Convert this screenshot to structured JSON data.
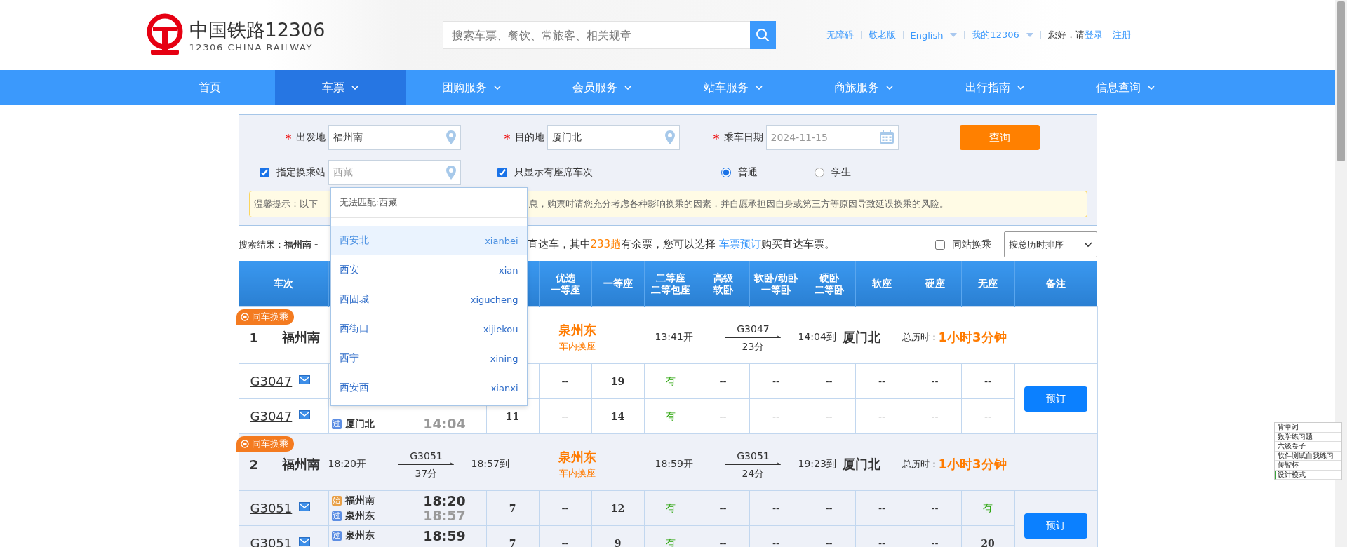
{
  "header": {
    "logo_title": "中国铁路12306",
    "logo_subtitle": "12306 CHINA RAILWAY",
    "search": {
      "placeholder": "搜索车票、餐饮、常旅客、相关规章"
    },
    "links": [
      {
        "label": "无障碍",
        "dropdown": false
      },
      {
        "label": "敬老版",
        "dropdown": false
      },
      {
        "label": "English",
        "dropdown": true
      },
      {
        "label": "我的12306",
        "dropdown": true
      }
    ],
    "greeting": "您好，请",
    "login": "登录",
    "register": "注册"
  },
  "nav": [
    {
      "label": "首页",
      "selected": false,
      "dropdown": false
    },
    {
      "label": "车票",
      "selected": true,
      "dropdown": true
    },
    {
      "label": "团购服务",
      "selected": false,
      "dropdown": true
    },
    {
      "label": "会员服务",
      "selected": false,
      "dropdown": true
    },
    {
      "label": "站车服务",
      "selected": false,
      "dropdown": true
    },
    {
      "label": "商旅服务",
      "selected": false,
      "dropdown": true
    },
    {
      "label": "出行指南",
      "selected": false,
      "dropdown": true
    },
    {
      "label": "信息查询",
      "selected": false,
      "dropdown": true
    }
  ],
  "form": {
    "fields": [
      {
        "required_mark": "*",
        "label": "出发地",
        "value": "福州南",
        "kind": "place"
      },
      {
        "required_mark": "*",
        "label": "目的地",
        "value": "厦门北",
        "kind": "place"
      },
      {
        "required_mark": "*",
        "label": "乘车日期",
        "value": "2024-11-15",
        "kind": "date"
      }
    ],
    "query_button": "查询",
    "transfer": {
      "label": "指定换乘站",
      "checked": true,
      "value": "西藏"
    },
    "seat_only": {
      "label": "只显示有座席车次",
      "checked": true
    },
    "ticket_types": [
      {
        "label": "普通",
        "selected": true
      },
      {
        "label": "学生",
        "selected": false
      }
    ],
    "tip_left": "温馨提示：以下",
    "tip_right": "息，购票时请您充分考虑各种影响换乘的因素，并自愿承担因自身或第三方等原因导致延误换乘的风险。"
  },
  "results": {
    "left": "搜索结果：**福州南 -**",
    "summary": [
      {
        "kind": "text",
        "text": "直达车，其中"
      },
      {
        "kind": "count",
        "text": "233趟"
      },
      {
        "kind": "text",
        "text": "有余票，您可以选择 "
      },
      {
        "kind": "link",
        "text": "车票预订"
      },
      {
        "kind": "text",
        "text": "购买直达车票。"
      }
    ],
    "same_station": {
      "label": "同站换乘",
      "checked": false
    },
    "sort": "按总历时排序"
  },
  "table": {
    "columns": [
      {
        "lines": [
          "车次"
        ]
      },
      {
        "lines": [
          "优选",
          "一等座"
        ]
      },
      {
        "lines": [
          "一等座"
        ]
      },
      {
        "lines": [
          "二等座",
          "二等包座"
        ]
      },
      {
        "lines": [
          "高级",
          "软卧"
        ]
      },
      {
        "lines": [
          "软卧/动卧",
          "一等卧"
        ]
      },
      {
        "lines": [
          "硬卧",
          "二等卧"
        ]
      },
      {
        "lines": [
          "软座"
        ]
      },
      {
        "lines": [
          "硬座"
        ]
      },
      {
        "lines": [
          "无座"
        ]
      },
      {
        "lines": [
          "备注"
        ]
      }
    ],
    "groups": [
      {
        "badge": "同车换乘",
        "index": "1",
        "from": "福州南",
        "highlighted": false,
        "leg2": {
          "dep": "13:41开",
          "train": "G3047",
          "duration": "23分",
          "arr": "14:04到"
        },
        "transfer": {
          "station": "泉州东",
          "note": "车内换座"
        },
        "to": "厦门北",
        "total_label": "总历时：",
        "total": "1小时3分钟",
        "book": "预订",
        "trains": [
          {
            "number": "G3047",
            "seats": [
              {
                "kind": "none",
                "text": "--"
              },
              {
                "kind": "count",
                "text": "19"
              },
              {
                "kind": "available",
                "text": "有"
              },
              {
                "kind": "none",
                "text": "--"
              },
              {
                "kind": "none",
                "text": "--"
              },
              {
                "kind": "none",
                "text": "--"
              },
              {
                "kind": "none",
                "text": "--"
              },
              {
                "kind": "none",
                "text": "--"
              },
              {
                "kind": "none",
                "text": "--"
              }
            ]
          },
          {
            "number": "G3047",
            "stops": [
              {
                "kind": "pass",
                "mark": "过",
                "name": "厦门北"
              }
            ],
            "times": [
              "14:04"
            ],
            "seats": [
              {
                "kind": "count",
                "text": "11"
              },
              {
                "kind": "none",
                "text": "--"
              },
              {
                "kind": "count",
                "text": "14"
              },
              {
                "kind": "available",
                "text": "有"
              },
              {
                "kind": "none",
                "text": "--"
              },
              {
                "kind": "none",
                "text": "--"
              },
              {
                "kind": "none",
                "text": "--"
              },
              {
                "kind": "none",
                "text": "--"
              },
              {
                "kind": "none",
                "text": "--"
              },
              {
                "kind": "none",
                "text": "--"
              }
            ]
          }
        ]
      },
      {
        "badge": "同车换乘",
        "index": "2",
        "from": "福州南",
        "highlighted": true,
        "leg1": {
          "dep": "18:20开",
          "train": "G3051",
          "duration": "37分",
          "arr": "18:57到"
        },
        "leg2": {
          "dep": "18:59开",
          "train": "G3051",
          "duration": "24分",
          "arr": "19:23到"
        },
        "transfer": {
          "station": "泉州东",
          "note": "车内换座"
        },
        "to": "厦门北",
        "total_label": "总历时：",
        "total": "1小时3分钟",
        "book": "预订",
        "trains": [
          {
            "number": "G3051",
            "stops": [
              {
                "kind": "start",
                "mark": "始",
                "name": "福州南"
              },
              {
                "kind": "pass",
                "mark": "过",
                "name": "泉州东"
              }
            ],
            "times": [
              "18:20",
              "18:57"
            ],
            "seats": [
              {
                "kind": "count",
                "text": "7"
              },
              {
                "kind": "none",
                "text": "--"
              },
              {
                "kind": "count",
                "text": "12"
              },
              {
                "kind": "available",
                "text": "有"
              },
              {
                "kind": "none",
                "text": "--"
              },
              {
                "kind": "none",
                "text": "--"
              },
              {
                "kind": "none",
                "text": "--"
              },
              {
                "kind": "none",
                "text": "--"
              },
              {
                "kind": "none",
                "text": "--"
              },
              {
                "kind": "available",
                "text": "有"
              }
            ]
          },
          {
            "number": "G3051",
            "stops": [
              {
                "kind": "pass",
                "mark": "过",
                "name": "泉州东"
              }
            ],
            "times": [
              "18:59"
            ],
            "seats": [
              {
                "kind": "count",
                "text": "7"
              },
              {
                "kind": "none",
                "text": "--"
              },
              {
                "kind": "count",
                "text": "9"
              },
              {
                "kind": "available",
                "text": "有"
              },
              {
                "kind": "none",
                "text": "--"
              },
              {
                "kind": "none",
                "text": "--"
              },
              {
                "kind": "none",
                "text": "--"
              },
              {
                "kind": "none",
                "text": "--"
              },
              {
                "kind": "none",
                "text": "--"
              },
              {
                "kind": "count",
                "text": "20"
              }
            ]
          }
        ]
      }
    ]
  },
  "station_dropdown": {
    "message": "无法匹配:西藏",
    "items": [
      {
        "name": "西安北",
        "pinyin": "xianbei",
        "selected": true
      },
      {
        "name": "西安",
        "pinyin": "xian",
        "selected": false
      },
      {
        "name": "西固城",
        "pinyin": "xigucheng",
        "selected": false
      },
      {
        "name": "西街口",
        "pinyin": "xijiekou",
        "selected": false
      },
      {
        "name": "西宁",
        "pinyin": "xining",
        "selected": false
      },
      {
        "name": "西安西",
        "pinyin": "xianxi",
        "selected": false
      }
    ]
  },
  "side_list": [
    {
      "label": "背单词",
      "selected": false
    },
    {
      "label": "数学练习题",
      "selected": false
    },
    {
      "label": "六级卷子",
      "selected": false
    },
    {
      "label": "软件测试自我练习",
      "selected": false
    },
    {
      "label": "传智杯",
      "selected": false
    },
    {
      "label": "设计模式",
      "selected": true
    }
  ]
}
